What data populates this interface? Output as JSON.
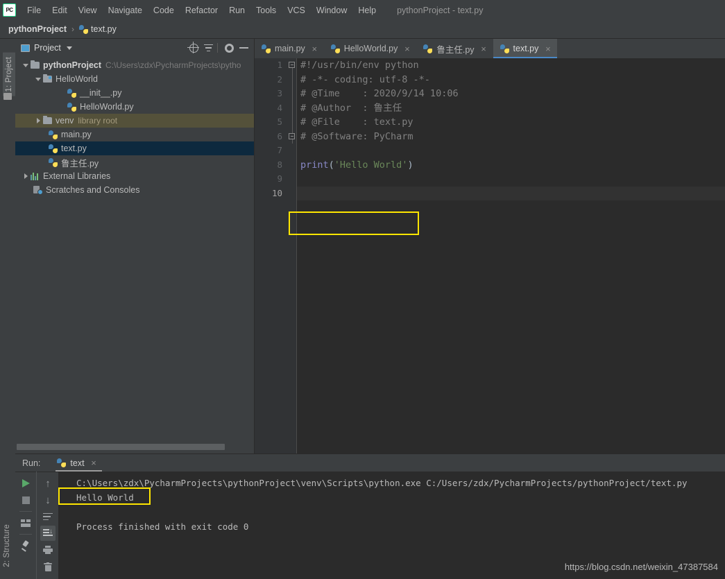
{
  "window": {
    "title": "pythonProject - text.py",
    "logo_text": "PC"
  },
  "menubar": {
    "items": [
      {
        "label": "File"
      },
      {
        "label": "Edit"
      },
      {
        "label": "View"
      },
      {
        "label": "Navigate"
      },
      {
        "label": "Code"
      },
      {
        "label": "Refactor"
      },
      {
        "label": "Run"
      },
      {
        "label": "Tools"
      },
      {
        "label": "VCS"
      },
      {
        "label": "Window"
      },
      {
        "label": "Help"
      }
    ]
  },
  "breadcrumb": {
    "project": "pythonProject",
    "separator": "›",
    "file": "text.py"
  },
  "left_strip": {
    "project_tab": "1: Project",
    "structure_tab": "2: Structure"
  },
  "project_panel": {
    "title": "Project",
    "icons": [
      "locate-target-icon",
      "collapse-all-icon",
      "settings-gear-icon",
      "minimize-icon"
    ],
    "tree": [
      {
        "label": "pythonProject",
        "sub": "C:\\Users\\zdx\\PycharmProjects\\pytho",
        "indent": 0,
        "icon": "folder",
        "arrow": "open",
        "bold": true,
        "state": "none"
      },
      {
        "label": "HelloWorld",
        "sub": "",
        "indent": 1,
        "icon": "folder-src",
        "arrow": "open",
        "bold": false,
        "state": "none"
      },
      {
        "label": "__init__.py",
        "sub": "",
        "indent": 3,
        "icon": "python",
        "arrow": "none",
        "bold": false,
        "state": "none"
      },
      {
        "label": "HelloWorld.py",
        "sub": "",
        "indent": 3,
        "icon": "python",
        "arrow": "none",
        "bold": false,
        "state": "none"
      },
      {
        "label": "venv",
        "sub": "library root",
        "indent": 1,
        "icon": "folder",
        "arrow": "closed",
        "bold": false,
        "state": "venv"
      },
      {
        "label": "main.py",
        "sub": "",
        "indent": 2,
        "icon": "python",
        "arrow": "none",
        "bold": false,
        "state": "none"
      },
      {
        "label": "text.py",
        "sub": "",
        "indent": 2,
        "icon": "python",
        "arrow": "none",
        "bold": false,
        "state": "selected"
      },
      {
        "label": "鲁主任.py",
        "sub": "",
        "indent": 2,
        "icon": "python",
        "arrow": "none",
        "bold": false,
        "state": "none"
      },
      {
        "label": "External Libraries",
        "sub": "",
        "indent": 0,
        "icon": "library",
        "arrow": "closed",
        "bold": false,
        "state": "none"
      },
      {
        "label": "Scratches and Consoles",
        "sub": "",
        "indent": 1,
        "icon": "scratch",
        "arrow": "none",
        "bold": false,
        "state": "none"
      }
    ]
  },
  "editor": {
    "tabs": [
      {
        "label": "main.py",
        "active": false,
        "close": "×"
      },
      {
        "label": "HelloWorld.py",
        "active": false,
        "close": "×"
      },
      {
        "label": "鲁主任.py",
        "active": false,
        "close": "×"
      },
      {
        "label": "text.py",
        "active": true,
        "close": "×"
      }
    ],
    "line_numbers": [
      "1",
      "2",
      "3",
      "4",
      "5",
      "6",
      "7",
      "8",
      "9",
      "10"
    ],
    "current_line": 10,
    "lines": [
      {
        "n": 1,
        "tokens": [
          {
            "t": "#!/usr/bin/env python",
            "c": "comment"
          }
        ]
      },
      {
        "n": 2,
        "tokens": [
          {
            "t": "# -*- coding: utf-8 -*-",
            "c": "comment"
          }
        ]
      },
      {
        "n": 3,
        "tokens": [
          {
            "t": "# @Time    : 2020/9/14 10:06",
            "c": "comment"
          }
        ]
      },
      {
        "n": 4,
        "tokens": [
          {
            "t": "# @Author  : 鲁主任",
            "c": "comment"
          }
        ]
      },
      {
        "n": 5,
        "tokens": [
          {
            "t": "# @File    : text.py",
            "c": "comment"
          }
        ]
      },
      {
        "n": 6,
        "tokens": [
          {
            "t": "# @Software: PyCharm",
            "c": "comment"
          }
        ]
      },
      {
        "n": 7,
        "tokens": [
          {
            "t": "",
            "c": "punct"
          }
        ]
      },
      {
        "n": 8,
        "tokens": [
          {
            "t": "print",
            "c": "kw"
          },
          {
            "t": "(",
            "c": "punct"
          },
          {
            "t": "'Hello World'",
            "c": "str"
          },
          {
            "t": ")",
            "c": "punct"
          }
        ]
      },
      {
        "n": 9,
        "tokens": [
          {
            "t": "",
            "c": "punct"
          }
        ]
      },
      {
        "n": 10,
        "tokens": [
          {
            "t": "",
            "c": "punct"
          }
        ]
      }
    ],
    "highlight_color": "#ffe600"
  },
  "run_panel": {
    "run_label": "Run:",
    "tab_label": "text",
    "tab_close": "×",
    "toolbar_left": [
      "run-play-icon",
      "stop-icon",
      "layout-icon",
      "pin-icon"
    ],
    "toolbar_right": [
      "arrow-up-icon",
      "arrow-down-icon",
      "soft-wrap-icon",
      "scroll-to-end-icon",
      "print-icon",
      "trash-icon"
    ],
    "console": [
      "C:\\Users\\zdx\\PycharmProjects\\pythonProject\\venv\\Scripts\\python.exe C:/Users/zdx/PycharmProjects/pythonProject/text.py",
      "Hello World",
      "",
      "Process finished with exit code 0"
    ]
  },
  "watermark": "https://blog.csdn.net/weixin_47387584"
}
